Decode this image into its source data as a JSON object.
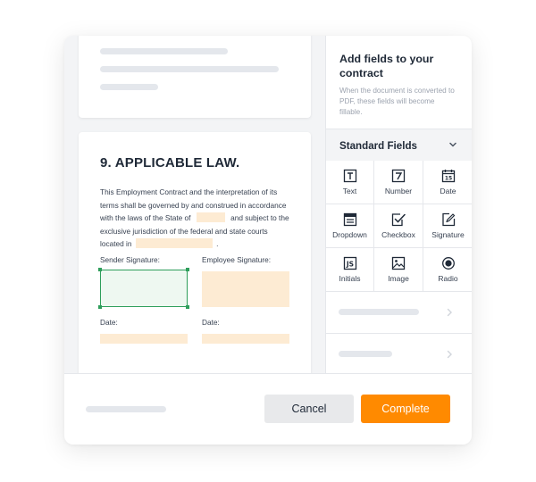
{
  "document": {
    "section_title": "9. APPLICABLE LAW.",
    "body_line1": "This Employment Contract and the interpretation of its",
    "body_line2": "terms shall be governed by and construed in accordance",
    "body_line3a": "with the laws of the State of",
    "body_line3b": "and subject to the",
    "body_line4": "exclusive jurisdiction of the federal and state courts",
    "body_line5a": "located in",
    "body_line5b": ".",
    "sender_signature_label": "Sender Signature:",
    "employee_signature_label": "Employee Signature:",
    "date_label_left": "Date:",
    "date_label_right": "Date:"
  },
  "sidebar": {
    "title": "Add fields to your contract",
    "description": "When the document is converted to PDF, these fields will become fillable.",
    "section_label": "Standard Fields",
    "fields": [
      {
        "label": "Text",
        "icon": "text-field-icon"
      },
      {
        "label": "Number",
        "icon": "number-field-icon"
      },
      {
        "label": "Date",
        "icon": "calendar-icon"
      },
      {
        "label": "Dropdown",
        "icon": "dropdown-icon"
      },
      {
        "label": "Checkbox",
        "icon": "checkbox-icon"
      },
      {
        "label": "Signature",
        "icon": "signature-icon"
      },
      {
        "label": "Initials",
        "icon": "initials-icon"
      },
      {
        "label": "Image",
        "icon": "image-icon"
      },
      {
        "label": "Radio",
        "icon": "radio-icon"
      }
    ]
  },
  "footer": {
    "cancel_label": "Cancel",
    "complete_label": "Complete"
  },
  "colors": {
    "accent": "#ff8a00",
    "field_fill": "#fdebd3",
    "selected_field_border": "#2e9e5b",
    "selected_field_fill": "#eef8f1"
  }
}
